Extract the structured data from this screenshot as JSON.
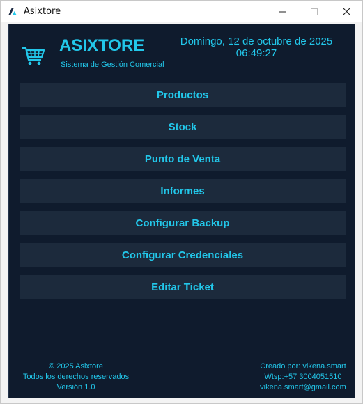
{
  "window": {
    "title": "Asixtore",
    "icon": "asixtore-logo-icon"
  },
  "header": {
    "brand": "ASIXTORE",
    "subtitle": "Sistema de Gestión Comercial",
    "date": "Domingo, 12 de octubre de 2025",
    "time": "06:49:27",
    "logo_icon": "shopping-cart-icon"
  },
  "menu": {
    "items": [
      {
        "label": "Productos"
      },
      {
        "label": "Stock"
      },
      {
        "label": "Punto de Venta"
      },
      {
        "label": "Informes"
      },
      {
        "label": "Configurar Backup"
      },
      {
        "label": "Configurar Credenciales"
      },
      {
        "label": "Editar Ticket"
      }
    ]
  },
  "footer": {
    "left": [
      "© 2025 Asixtore",
      "Todos los derechos reservados",
      "Versión 1.0"
    ],
    "right": [
      "Creado por: vikena.smart",
      "Wtsp:+57 3004051510",
      "vikena.smart@gmail.com"
    ]
  },
  "colors": {
    "background": "#0f1b2d",
    "button": "#1c2a3c",
    "accent": "#22c7ea"
  }
}
